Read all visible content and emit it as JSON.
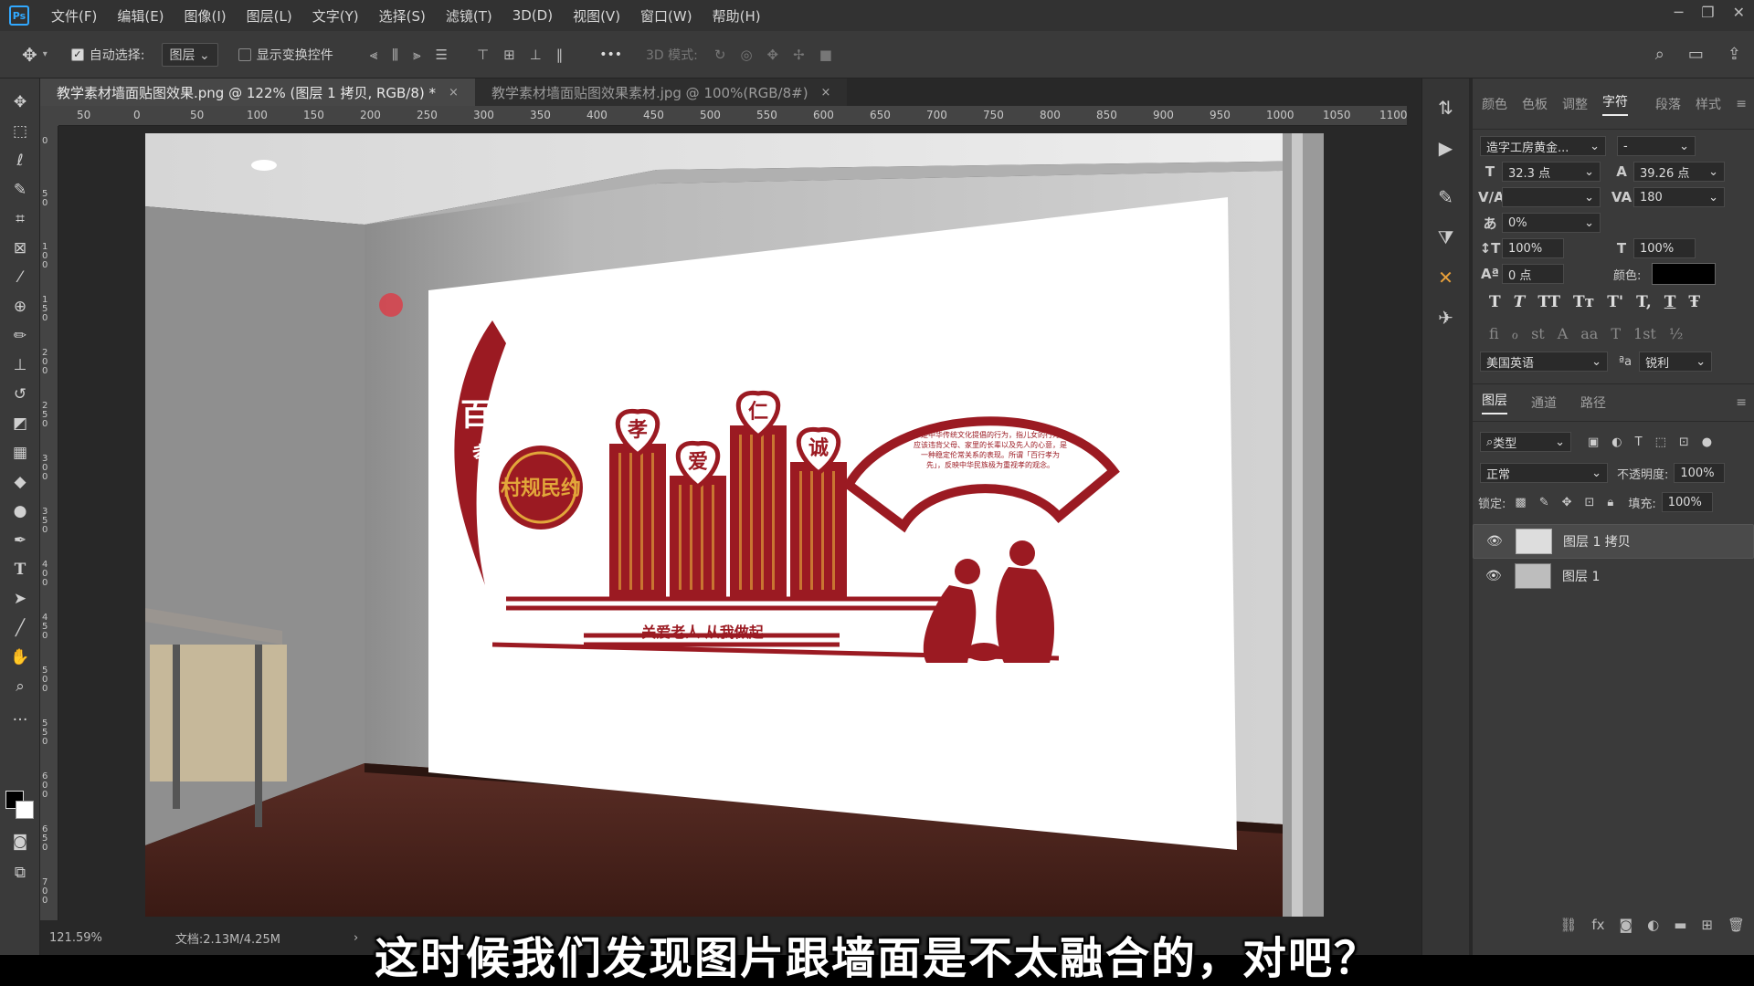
{
  "app": {
    "logo": "Ps"
  },
  "menu": [
    "文件(F)",
    "编辑(E)",
    "图像(I)",
    "图层(L)",
    "文字(Y)",
    "选择(S)",
    "滤镜(T)",
    "3D(D)",
    "视图(V)",
    "窗口(W)",
    "帮助(H)"
  ],
  "options": {
    "auto_select_label": "自动选择:",
    "auto_select_value": "图层",
    "show_transform_label": "显示变换控件",
    "mode_3d_label": "3D 模式:",
    "more": "•••"
  },
  "tabs": [
    {
      "title": "教学素材墙面贴图效果.png @ 122% (图层 1 拷贝, RGB/8) *",
      "close": "×"
    },
    {
      "title": "教学素材墙面贴图效果素材.jpg @ 100%(RGB/8#)",
      "close": "×"
    }
  ],
  "ruler_ticks": [
    "50",
    "0",
    "50",
    "100",
    "150",
    "200",
    "250",
    "300",
    "350",
    "400",
    "450",
    "500",
    "550",
    "600",
    "650",
    "700",
    "750",
    "800",
    "850",
    "900",
    "950",
    "1000",
    "1050",
    "1100"
  ],
  "ruler_left_ticks": [
    "0",
    "50",
    "100",
    "150",
    "200",
    "250",
    "300",
    "350",
    "400",
    "450",
    "500",
    "550",
    "600",
    "650",
    "700"
  ],
  "status": {
    "zoom": "121.59%",
    "doc": "文档:2.13M/4.25M",
    "arrow": "›"
  },
  "artwork": {
    "banner_text_1": "百善",
    "banner_text_2": "孝当先",
    "seal_text": "村规民约",
    "heart_chars": [
      "孝",
      "爱",
      "仁",
      "诚"
    ],
    "slogan": "关爱老人 从我做起",
    "fan_text": "孝是中华传统文化提倡的行为，指儿女的行为不应该违背父母、家里的长辈以及先人的心意，是一种稳定伦常关系的表现。所谓「百行孝为先」，反映中华民族极为重视孝的观念。"
  },
  "right_panel": {
    "tabs": [
      "颜色",
      "色板",
      "调整",
      "字符",
      "段落",
      "样式"
    ],
    "active_tab": "字符",
    "font_family": "造字工房黄金...",
    "font_style": "-",
    "font_size": "32.3 点",
    "leading": "39.26 点",
    "kerning": "",
    "tracking": "180",
    "scale_pct": "0%",
    "vscale": "100%",
    "hscale": "100%",
    "baseline": "0 点",
    "color_label": "颜色:",
    "color_value": "#000000",
    "typo_buttons": [
      "T",
      "T",
      "TT",
      "Tт",
      "T'",
      "T,",
      "T",
      "Ŧ"
    ],
    "opentype_buttons": [
      "fi",
      "ℴ",
      "st",
      "A",
      "aa",
      "T",
      "1st",
      "½"
    ],
    "language": "美国英语",
    "aa_label": "ªa",
    "antialias": "锐利"
  },
  "layers_panel": {
    "tabs": [
      "图层",
      "通道",
      "路径"
    ],
    "filter_kind": "类型",
    "blend_mode": "正常",
    "opacity_label": "不透明度:",
    "opacity": "100%",
    "lock_label": "锁定:",
    "fill_label": "填充:",
    "fill": "100%",
    "layers": [
      {
        "name": "图层 1 拷贝",
        "selected": true
      },
      {
        "name": "图层 1",
        "selected": false
      }
    ]
  },
  "subtitle": "这时候我们发现图片跟墙面是不太融合的，对吧？",
  "colors": {
    "accent_red": "#9b1a22",
    "gold": "#e2a63a"
  }
}
